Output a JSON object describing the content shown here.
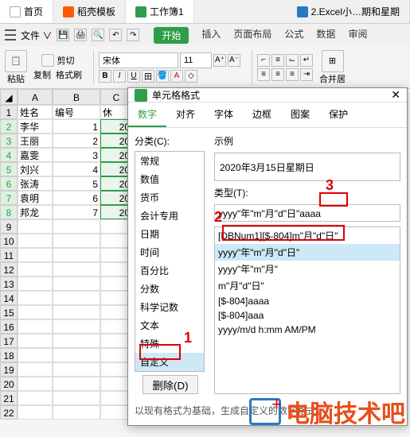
{
  "top_tabs": {
    "home": "首页",
    "daoke": "稻壳模板",
    "workbook": "工作簿1",
    "excel": "2.Excel小…期和星期"
  },
  "file_btn": "文件",
  "ribbon": {
    "start": "开始",
    "insert": "插入",
    "layout": "页面布局",
    "formula": "公式",
    "data": "数据",
    "review": "审阅"
  },
  "toolbar": {
    "paste": "粘贴",
    "copy": "复制",
    "format_painter": "格式刷",
    "font": "宋体",
    "size": "11",
    "merge": "合并居"
  },
  "sheet": {
    "cols": [
      "A",
      "B",
      "C"
    ],
    "header": {
      "a": "姓名",
      "b": "编号",
      "c": "休"
    },
    "rows": [
      {
        "n": "2",
        "a": "李华",
        "b": "1",
        "c": "20"
      },
      {
        "n": "3",
        "a": "王丽",
        "b": "2",
        "c": "20"
      },
      {
        "n": "4",
        "a": "嘉雯",
        "b": "3",
        "c": "20"
      },
      {
        "n": "5",
        "a": "刘兴",
        "b": "4",
        "c": "20"
      },
      {
        "n": "6",
        "a": "张涛",
        "b": "5",
        "c": "20"
      },
      {
        "n": "7",
        "a": "袁明",
        "b": "6",
        "c": "20"
      },
      {
        "n": "8",
        "a": "邦龙",
        "b": "7",
        "c": "20"
      }
    ]
  },
  "dialog": {
    "title": "单元格格式",
    "tabs": {
      "number": "数字",
      "align": "对齐",
      "font": "字体",
      "border": "边框",
      "pattern": "图案",
      "protect": "保护"
    },
    "category_label": "分类(C):",
    "categories": [
      "常规",
      "数值",
      "货币",
      "会计专用",
      "日期",
      "时间",
      "百分比",
      "分数",
      "科学记数",
      "文本",
      "特殊",
      "自定义"
    ],
    "sample_label": "示例",
    "sample_value": "2020年3月15日星期日",
    "type_label": "类型(T):",
    "type_value": "yyyy\"年\"m\"月\"d\"日\"aaaa",
    "type_list": [
      "[DBNum1][$-804]m\"月\"d\"日\"",
      "yyyy\"年\"m\"月\"d\"日\"",
      "yyyy\"年\"m\"月\"",
      "m\"月\"d\"日\"",
      "[$-804]aaaa",
      "[$-804]aaa",
      "yyyy/m/d h:mm AM/PM"
    ],
    "delete_btn": "删除(D)",
    "hint": "以现有格式为基础，生成自定义的数字格式。",
    "marks": {
      "m1": "1",
      "m2": "2",
      "m3": "3"
    }
  },
  "watermark": "电脑技术吧"
}
